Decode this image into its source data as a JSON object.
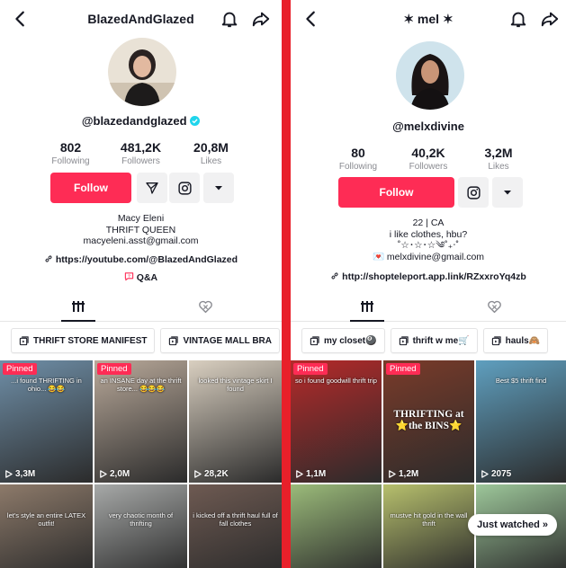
{
  "left": {
    "title": "BlazedAndGlazed",
    "handle": "@blazedandglazed",
    "stats": [
      {
        "value": "802",
        "label": "Following"
      },
      {
        "value": "481,2K",
        "label": "Followers"
      },
      {
        "value": "20,8M",
        "label": "Likes"
      }
    ],
    "follow_label": "Follow",
    "bio": [
      "Macy Eleni",
      "THRIFT QUEEN",
      "macyeleni.asst@gmail.com"
    ],
    "link": "https://youtube.com/@BlazedAndGlazed",
    "qa": "Q&A",
    "playlists": [
      "THRIFT STORE MANIFEST",
      "VINTAGE MALL BRA"
    ],
    "videos": [
      {
        "pinned": "Pinned",
        "caption": "...i found THRIFTING in ohio... 😂😂",
        "views": "3,3M",
        "color": "#6f8fa8"
      },
      {
        "pinned": "Pinned",
        "caption": "an INSANE day at the thrift store... 😂😂😂",
        "views": "2,0M",
        "color": "#b9a99a"
      },
      {
        "pinned": "",
        "caption": "looked this vintage skirt I found",
        "views": "28,2K",
        "color": "#d9cfc0"
      },
      {
        "pinned": "",
        "caption": "let's style an entire LATEX outfit!",
        "views": "",
        "color": "#8d7a6a"
      },
      {
        "pinned": "",
        "caption": "very chaotic month of thrifting",
        "views": "",
        "color": "#a7a9a8"
      },
      {
        "pinned": "",
        "caption": "i kicked off a thrift haul full of fall clothes",
        "views": "",
        "color": "#6e5a52"
      }
    ]
  },
  "right": {
    "title": "✶ mel ✶",
    "handle": "@melxdivine",
    "stats": [
      {
        "value": "80",
        "label": "Following"
      },
      {
        "value": "40,2K",
        "label": "Followers"
      },
      {
        "value": "3,2M",
        "label": "Likes"
      }
    ],
    "follow_label": "Follow",
    "bio": [
      "22 | CA",
      "i like clothes, hbu?",
      "˚☆･☆･☆༄˚₊‧˚"
    ],
    "email": "💌 melxdivine@gmail.com",
    "link": "http://shopteleport.app.link/RZxxroYq4zb",
    "playlists": [
      "my closet🎱",
      "thrift w me🛒",
      "hauls🙈"
    ],
    "videos": [
      {
        "pinned": "Pinned",
        "caption": "so i found goodwill thrift trip",
        "views": "1,1M",
        "color": "#b52a2a"
      },
      {
        "pinned": "Pinned",
        "caption": "THRIFTING at ⭐the BINS⭐",
        "views": "1,2M",
        "color": "#7a3b2a"
      },
      {
        "pinned": "",
        "caption": "Best $5 thrift find",
        "views": "2075",
        "color": "#5f9fbf"
      },
      {
        "pinned": "",
        "caption": "",
        "views": "",
        "color": "#9bbb7a"
      },
      {
        "pinned": "",
        "caption": "mustve hit gold in the wall thrift",
        "views": "",
        "color": "#b7c06d"
      },
      {
        "pinned": "",
        "caption": "",
        "views": "",
        "color": "#9dc79a"
      }
    ],
    "just_watched": "Just watched »"
  }
}
